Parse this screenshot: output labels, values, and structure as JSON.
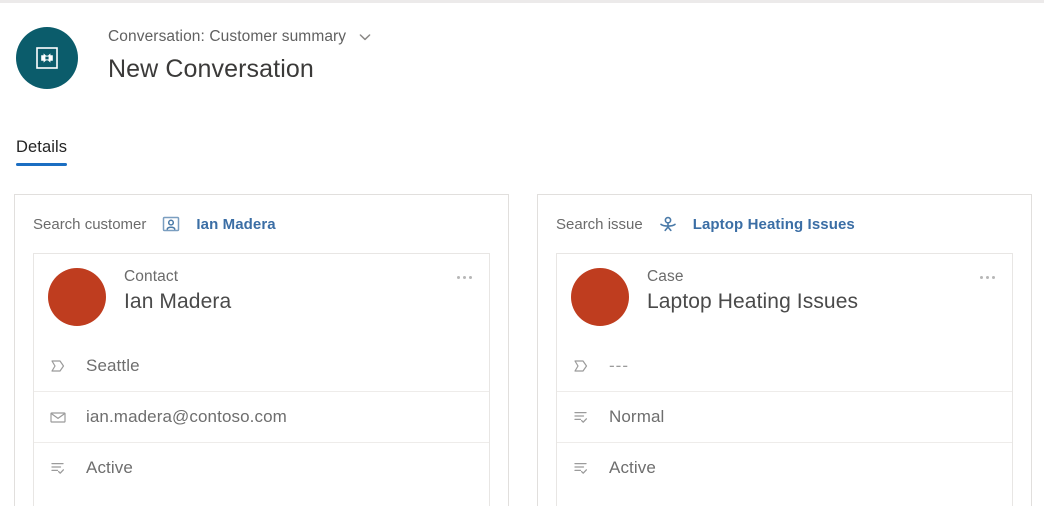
{
  "colors": {
    "header_avatar_bg": "#0b5c6b",
    "record_avatar_bg": "#bf3d1f",
    "tab_accent": "#1b6ec2",
    "link_blue": "#3b6ea5",
    "card_border": "#e1dfdd"
  },
  "header": {
    "avatar_icon": "conversation-entity-icon",
    "breadcrumb": "Conversation: Customer summary",
    "breadcrumb_chevron_icon": "chevron-down-icon",
    "title": "New Conversation"
  },
  "tabs": [
    {
      "label": "Details",
      "active": true
    }
  ],
  "cards": [
    {
      "id": "customer-card",
      "search": {
        "label": "Search customer",
        "entity_icon": "contact-card-icon",
        "entity_name": "Ian Madera"
      },
      "record": {
        "avatar_icon": "contact-avatar",
        "type": "Contact",
        "name": "Ian Madera",
        "overflow_icon": "more-options-icon",
        "rows": [
          {
            "icon": "location-tag-icon",
            "value": "Seattle",
            "muted": false
          },
          {
            "icon": "email-envelope-icon",
            "value": "ian.madera@contoso.com",
            "muted": false
          },
          {
            "icon": "status-list-icon",
            "value": "Active",
            "muted": false
          }
        ]
      }
    },
    {
      "id": "issue-card",
      "search": {
        "label": "Search issue",
        "entity_icon": "case-person-icon",
        "entity_name": "Laptop Heating Issues"
      },
      "record": {
        "avatar_icon": "case-avatar",
        "type": "Case",
        "name": "Laptop Heating Issues",
        "overflow_icon": "more-options-icon",
        "rows": [
          {
            "icon": "location-tag-icon",
            "value": "---",
            "muted": true
          },
          {
            "icon": "status-list-icon",
            "value": "Normal",
            "muted": false
          },
          {
            "icon": "status-list-icon",
            "value": "Active",
            "muted": false
          }
        ]
      }
    }
  ]
}
